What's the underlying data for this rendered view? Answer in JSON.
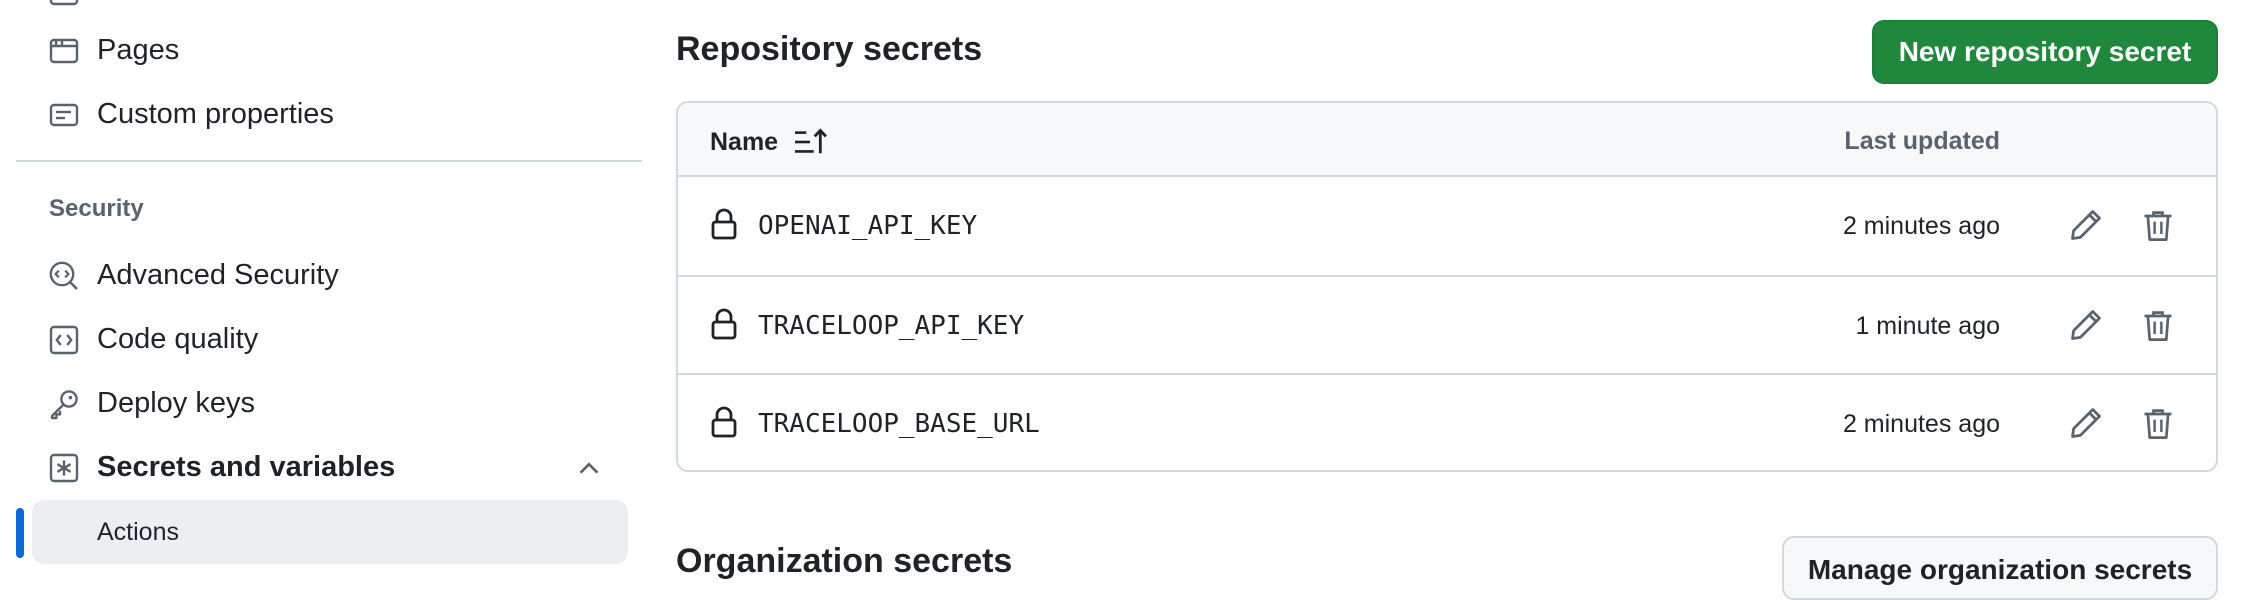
{
  "sidebar": {
    "items": [
      {
        "label": "Pages",
        "icon": "browser-icon"
      },
      {
        "label": "Custom properties",
        "icon": "note-icon"
      }
    ],
    "section_heading": "Security",
    "security_items": [
      {
        "label": "Advanced Security",
        "icon": "codescan-icon"
      },
      {
        "label": "Code quality",
        "icon": "code-square-icon"
      },
      {
        "label": "Deploy keys",
        "icon": "key-icon"
      },
      {
        "label": "Secrets and variables",
        "icon": "key-asterisk-icon",
        "expanded": true
      }
    ],
    "sub_items": [
      {
        "label": "Actions",
        "active": true
      }
    ]
  },
  "main": {
    "title": "Repository secrets",
    "new_button": "New repository secret",
    "table": {
      "col_name": "Name",
      "col_updated": "Last updated",
      "rows": [
        {
          "name": "OPENAI_API_KEY",
          "updated": "2 minutes ago"
        },
        {
          "name": "TRACELOOP_API_KEY",
          "updated": "1 minute ago"
        },
        {
          "name": "TRACELOOP_BASE_URL",
          "updated": "2 minutes ago"
        }
      ]
    },
    "org_title": "Organization secrets",
    "manage_button": "Manage organization secrets"
  },
  "colors": {
    "primary": "#1f883d",
    "accent": "#0969da",
    "border": "#d1d9e0",
    "muted": "#59636e",
    "text": "#1f2328"
  }
}
